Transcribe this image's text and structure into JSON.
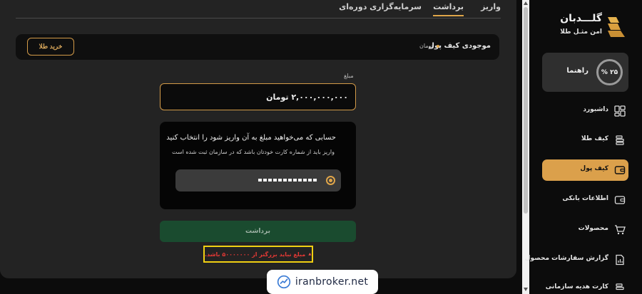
{
  "tabs": [
    {
      "label": "واریز",
      "active": false
    },
    {
      "label": "برداشت",
      "active": true
    },
    {
      "label": "سرمایه‌گزاری دوره‌ای",
      "active": false
    }
  ],
  "wallet": {
    "title": "موجودی کیف پول",
    "unit": "تومان",
    "buy_button": "خرید طلا"
  },
  "amount": {
    "label": "مبلغ",
    "value": "۲,۰۰۰,۰۰۰,۰۰۰ تومان"
  },
  "account_select": {
    "title": "حسابی که می‌خواهید مبلغ به آن واریز شود را انتخاب کنید",
    "subtitle": "واریز باید از شماره کارت خودتان باشد که در سازمان ثبت شده است"
  },
  "withdraw_button": "برداشت",
  "error": {
    "message": "مبلغ نباید بزرگتر از ۵۰۰۰۰۰۰۰ باشد.",
    "color": "#e53935"
  },
  "sidebar": {
    "logo_title": "گلـــدبان",
    "logo_subtitle": "امن مثـل طلا",
    "guide": {
      "percent": "۲۵ %",
      "label": "راهنما"
    },
    "items": [
      {
        "label": "داشبورد",
        "icon": "dashboard-icon",
        "active": false
      },
      {
        "label": "کیف طلا",
        "icon": "gold-bars-icon",
        "active": false
      },
      {
        "label": "کیف پول",
        "icon": "wallet-icon",
        "active": true
      },
      {
        "label": "اطلاعات بانکی",
        "icon": "bank-card-icon",
        "active": false
      },
      {
        "label": "محصولات",
        "icon": "cart-icon",
        "active": false
      },
      {
        "label": "گزارش سفارشات محصول",
        "icon": "report-icon",
        "active": false
      },
      {
        "label": "کارت هدیه سازمانی",
        "icon": "gift-card-icon",
        "active": false
      }
    ]
  },
  "watermark": "iranbroker.net",
  "colors": {
    "accent": "#dba04b",
    "withdraw": "#1a4b2f",
    "error_border": "#f0cf12"
  }
}
